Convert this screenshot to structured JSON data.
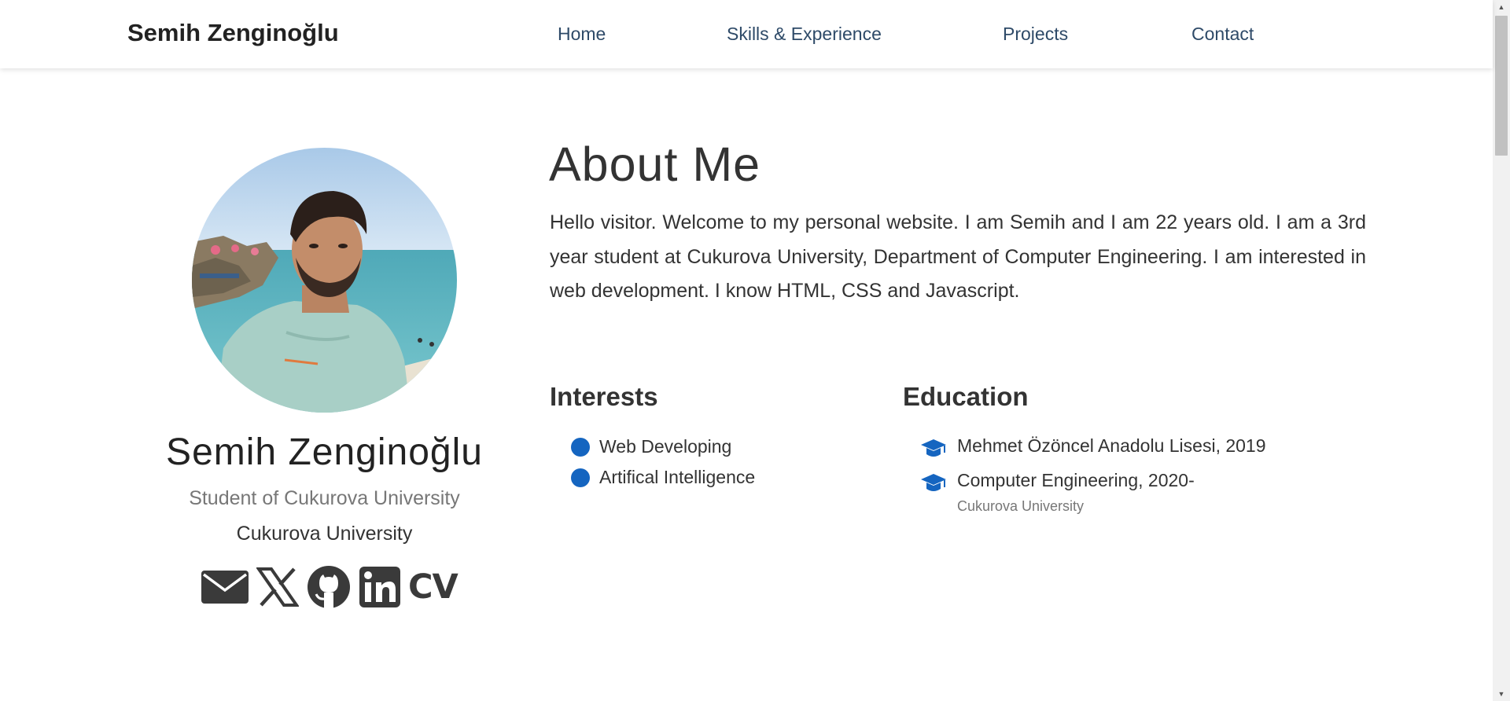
{
  "navbar": {
    "brand": "Semih Zenginoğlu",
    "links": [
      "Home",
      "Skills & Experience",
      "Projects",
      "Contact"
    ]
  },
  "profile": {
    "name": "Semih Zenginoğlu",
    "role": "Student of Cukurova University",
    "university": "Cukurova University",
    "socials": [
      "email-icon",
      "x-icon",
      "github-icon",
      "linkedin-icon",
      "cv"
    ],
    "cv_label": "CV"
  },
  "about": {
    "title": "About Me",
    "text": "Hello visitor. Welcome to my personal website. I am Semih and I am 22 years old. I am a 3rd year student at Cukurova University, Department of Computer Engineering. I am interested in web development. I know HTML, CSS and Javascript."
  },
  "interests": {
    "title": "Interests",
    "items": [
      "Web Developing",
      "Artifical Intelligence"
    ]
  },
  "education": {
    "title": "Education",
    "items": [
      {
        "title": "Mehmet Özöncel Anadolu Lisesi, 2019",
        "sub": ""
      },
      {
        "title": "Computer Engineering, 2020-",
        "sub": "Cukurova University"
      }
    ]
  },
  "colors": {
    "accent": "#1565c0",
    "nav_text": "#2e4a68",
    "text": "#333333",
    "muted": "#777777"
  }
}
